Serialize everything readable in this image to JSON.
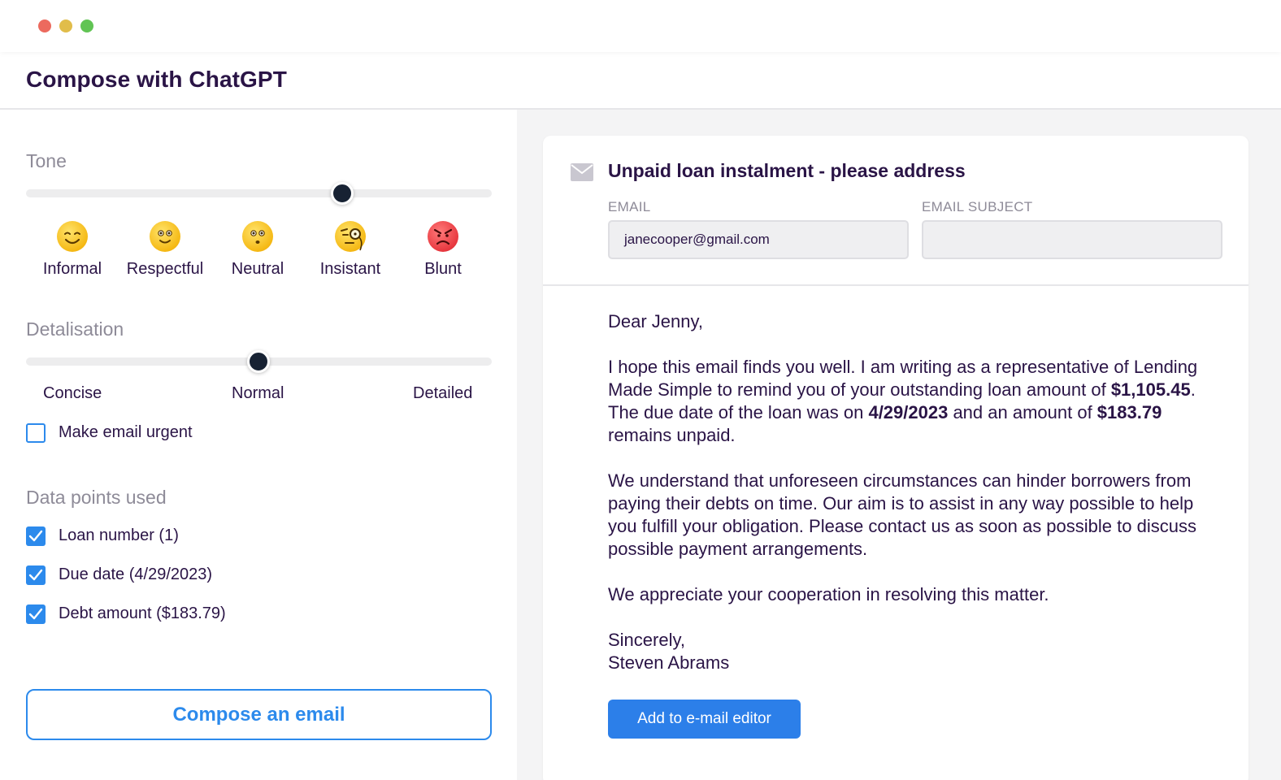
{
  "window": {
    "controls": [
      {
        "name": "close",
        "color": "#ec6a5e"
      },
      {
        "name": "minimize",
        "color": "#e1bd4a"
      },
      {
        "name": "zoom",
        "color": "#61c454"
      }
    ]
  },
  "header": {
    "title": "Compose with ChatGPT"
  },
  "tone": {
    "label": "Tone",
    "selected": "Insistant",
    "slider_level": 0.68,
    "options": [
      {
        "label": "Informal",
        "icon": "smiling-face-icon"
      },
      {
        "label": "Respectful",
        "icon": "grinning-face-icon"
      },
      {
        "label": "Neutral",
        "icon": "neutral-face-icon"
      },
      {
        "label": "Insistant",
        "icon": "face-with-monocle-icon"
      },
      {
        "label": "Blunt",
        "icon": "angry-face-icon"
      }
    ]
  },
  "detalisation": {
    "label": "Detalisation",
    "selected": "Normal",
    "slider_level": 0.5,
    "options": [
      "Concise",
      "Normal",
      "Detailed"
    ]
  },
  "urgent": {
    "label": "Make email urgent",
    "checked": false
  },
  "data_points": {
    "label": "Data points used",
    "items": [
      {
        "label": "Loan number (1)",
        "checked": true
      },
      {
        "label": "Due date (4/29/2023)",
        "checked": true
      },
      {
        "label": "Debt amount ($183.79)",
        "checked": true
      }
    ]
  },
  "compose_button": "Compose an email",
  "email": {
    "title": "Unpaid loan instalment - please address",
    "email_label": "EMAIL",
    "email_value": "janecooper@gmail.com",
    "subject_label": "EMAIL SUBJECT",
    "subject_value": "",
    "body": {
      "greeting": "Dear Jenny,",
      "p1_a": "I hope this email finds you well. I am writing as a representative of Lending Made Simple to remind you of your outstanding loan amount of ",
      "p1_amount": "$1,105.45",
      "p1_b": ". The due date of the loan was on ",
      "p1_date": "4/29/2023",
      "p1_c": " and an amount of ",
      "p1_unpaid": "$183.79",
      "p1_d": " remains unpaid.",
      "p2": "We understand that unforeseen circumstances can hinder borrowers from paying their debts on time. Our aim is to assist in any way possible to help you fulfill your obligation. Please contact us as soon as possible to discuss possible payment arrangements.",
      "p3": "We appreciate your cooperation in resolving this matter.",
      "closing": "Sincerely,",
      "signature": "Steven Abrams"
    },
    "add_button": "Add to e-mail editor"
  },
  "colors": {
    "accent": "#2c8aec",
    "text": "#2a1446",
    "muted": "#8e8b98",
    "panel_bg": "#f4f4f5"
  }
}
